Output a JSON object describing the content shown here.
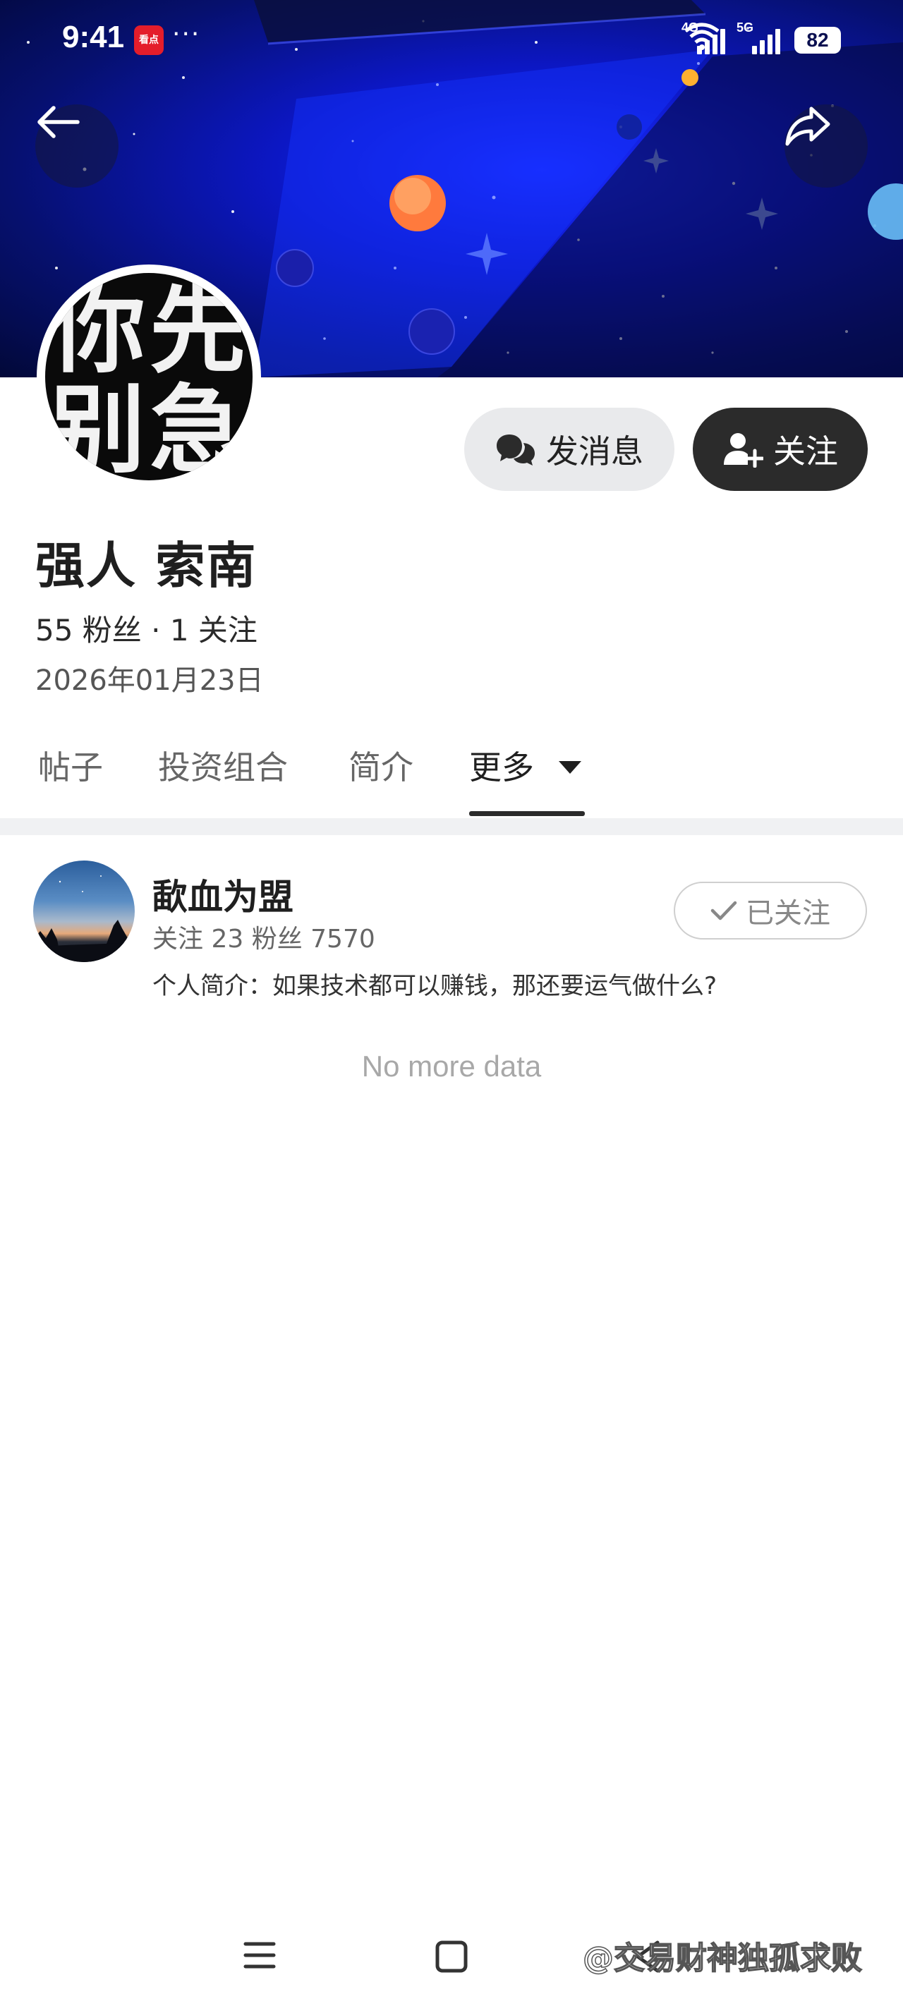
{
  "status_bar": {
    "time": "9:41",
    "app_icon_text": "看点",
    "dots": "···",
    "network_1": "4G",
    "network_2": "5G",
    "battery": "82"
  },
  "profile": {
    "avatar_chars": [
      "你",
      "先",
      "别",
      "急"
    ],
    "username": "强人 索南",
    "stats": "55 粉丝 · 1 关注",
    "joined_date": "2026年01月23日"
  },
  "actions": {
    "message_label": "发消息",
    "follow_label": "关注"
  },
  "tabs": [
    {
      "label": "帖子",
      "active": false
    },
    {
      "label": "投资组合",
      "active": false
    },
    {
      "label": "简介",
      "active": false
    },
    {
      "label": "更多",
      "active": true
    }
  ],
  "following_list": [
    {
      "name": "歃血为盟",
      "stats": "关注 23  粉丝 7570",
      "bio": "个人简介：如果技术都可以赚钱，那还要运气做什么?",
      "button_label": "已关注"
    }
  ],
  "list_footer": "No more data",
  "watermark": "@交易财神独孤求败",
  "colors": {
    "banner_blue": "#0c17c4",
    "follow_button_bg": "#2b2b2b",
    "message_button_bg": "#e9eaec"
  },
  "icons": [
    "back-arrow-icon",
    "share-icon",
    "chat-bubbles-icon",
    "add-user-icon",
    "check-icon",
    "menu-icon",
    "home-square-icon",
    "back-chevron-icon"
  ]
}
